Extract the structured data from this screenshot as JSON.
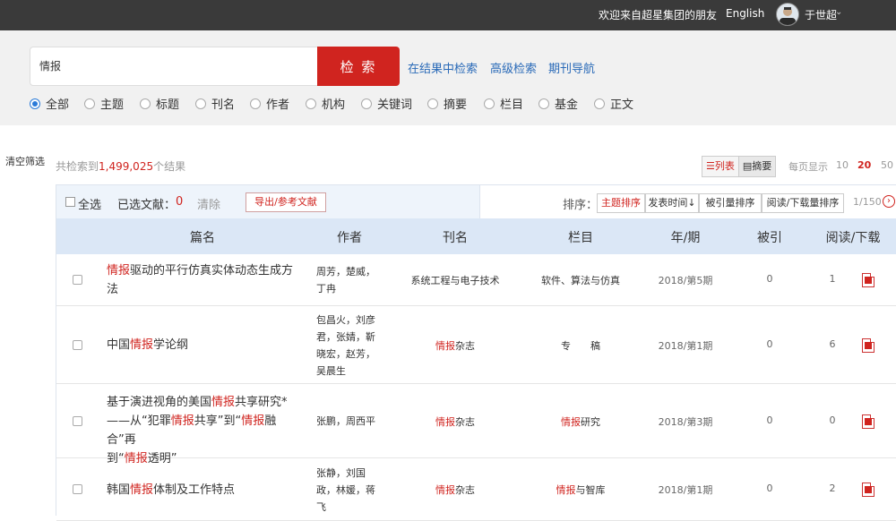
{
  "topbar": {
    "welcome": "欢迎来自超星集团的朋友",
    "language": "English",
    "username": "于世超",
    "caret": "⌄"
  },
  "search": {
    "query": "情报",
    "button": "检 索",
    "links": [
      "在结果中检索",
      "高级检索",
      "期刊导航"
    ]
  },
  "scopes": {
    "selected": 0,
    "items": [
      "全部",
      "主题",
      "标题",
      "刊名",
      "作者",
      "机构",
      "关键词",
      "摘要",
      "栏目",
      "基金",
      "正文"
    ]
  },
  "filter": {
    "clear": "清空筛选"
  },
  "summary": {
    "prefix": "共检索到",
    "count": "1,499,025",
    "suffix": "个结果"
  },
  "view": {
    "list": "☰列表",
    "abstract": "▤摘要",
    "per_page_label": "每页显示",
    "per_page_options": [
      "10",
      "20",
      "50"
    ],
    "per_page_selected": "20"
  },
  "toolbar": {
    "select_all": "全选",
    "selected_label": "已选文献：",
    "selected_count": "0",
    "clear": "清除",
    "export": "导出/参考文献",
    "sort_label": "排序：",
    "sort_options": [
      "主题排序",
      "发表时间↓",
      "被引量排序",
      "阅读/下载量排序"
    ],
    "page_info": "1/150",
    "next": "›"
  },
  "table": {
    "columns": [
      "篇名",
      "作者",
      "刊名",
      "栏目",
      "年/期",
      "被引",
      "阅读/下载"
    ],
    "rows": [
      {
        "title_lines": [
          [
            [
              "情报",
              "hl"
            ],
            [
              "驱动的平行仿真实体动态生成方",
              ""
            ]
          ],
          [
            [
              "法",
              ""
            ]
          ]
        ],
        "authors": [
          "周芳，楚威，",
          "丁冉"
        ],
        "journal": [
          [
            "系统工程与电子技术",
            ""
          ]
        ],
        "column": [
          [
            "软件、算法与仿真",
            "grey"
          ]
        ],
        "issue": "2018/第5期",
        "cited": "0",
        "reads": "1"
      },
      {
        "title_lines": [
          [
            [
              "中国",
              ""
            ],
            [
              "情报",
              "hl"
            ],
            [
              "学论纲",
              ""
            ]
          ]
        ],
        "authors": [
          "包昌火，刘彦",
          "君，张婧，靳",
          "晓宏，赵芳，",
          "吴晨生"
        ],
        "journal": [
          [
            "情报",
            "hl"
          ],
          [
            "杂志",
            ""
          ]
        ],
        "column": [
          [
            "专　　稿",
            "grey"
          ]
        ],
        "issue": "2018/第1期",
        "cited": "0",
        "reads": "6"
      },
      {
        "title_lines": [
          [
            [
              "基于演进视角的美国",
              ""
            ],
            [
              "情报",
              "hl"
            ],
            [
              "共享研究*",
              ""
            ]
          ],
          [
            [
              "——从“犯罪",
              ""
            ],
            [
              "情报",
              "hl"
            ],
            [
              "共享”到“",
              ""
            ],
            [
              "情报",
              "hl"
            ],
            [
              "融合”再",
              ""
            ]
          ],
          [
            [
              "到“",
              ""
            ],
            [
              "情报",
              "hl"
            ],
            [
              "透明”",
              ""
            ]
          ]
        ],
        "authors": [
          "张鹏，周西平"
        ],
        "journal": [
          [
            "情报",
            "hl"
          ],
          [
            "杂志",
            ""
          ]
        ],
        "column": [
          [
            "情报",
            "hl"
          ],
          [
            "研究",
            "grey"
          ]
        ],
        "issue": "2018/第3期",
        "cited": "0",
        "reads": "0"
      },
      {
        "title_lines": [
          [
            [
              "韩国",
              ""
            ],
            [
              "情报",
              "hl"
            ],
            [
              "体制及工作特点",
              ""
            ]
          ]
        ],
        "authors": [
          "张静，刘国",
          "政，林媛，蒋",
          "飞"
        ],
        "journal": [
          [
            "情报",
            "hl"
          ],
          [
            "杂志",
            ""
          ]
        ],
        "column": [
          [
            "情报",
            "hl"
          ],
          [
            "与智库",
            ""
          ]
        ],
        "issue": "2018/第1期",
        "cited": "0",
        "reads": "2"
      }
    ]
  }
}
